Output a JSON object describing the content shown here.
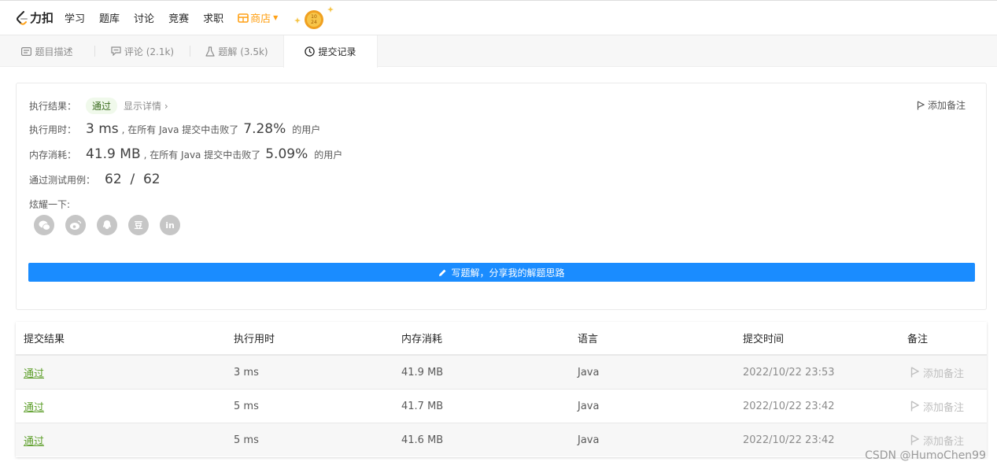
{
  "topnav": {
    "logo_text": "力扣",
    "items": [
      "学习",
      "题库",
      "讨论",
      "竞赛",
      "求职"
    ],
    "store_label": "商店"
  },
  "tabs": [
    {
      "label": "题目描述",
      "icon": "description-icon"
    },
    {
      "label": "评论 (2.1k)",
      "icon": "comment-icon"
    },
    {
      "label": "题解 (3.5k)",
      "icon": "flask-icon"
    },
    {
      "label": "提交记录",
      "icon": "clock-icon"
    }
  ],
  "result": {
    "label_result": "执行结果：",
    "badge": "通过",
    "details_link": "显示详情 ›",
    "add_note": "添加备注",
    "label_time": "执行用时：",
    "time_value": "3 ms",
    "time_mid": ", 在所有 Java 提交中击败了",
    "time_pct": "7.28%",
    "time_suffix": "的用户",
    "label_mem": "内存消耗：",
    "mem_value": "41.9 MB",
    "mem_mid": ", 在所有 Java 提交中击败了",
    "mem_pct": "5.09%",
    "mem_suffix": "的用户",
    "label_cases": "通过测试用例：",
    "cases_value": "62  /  62",
    "label_share": "炫耀一下:",
    "share_icons": [
      "wechat-icon",
      "weibo-icon",
      "qq-icon",
      "douban-icon",
      "linkedin-icon"
    ],
    "share_glyphs": [
      "",
      "",
      "",
      "豆",
      "in"
    ],
    "write_button": "写题解，分享我的解题思路"
  },
  "table": {
    "headers": [
      "提交结果",
      "执行用时",
      "内存消耗",
      "语言",
      "提交时间",
      "备注"
    ],
    "rows": [
      {
        "status": "通过",
        "runtime": "3 ms",
        "memory": "41.9 MB",
        "lang": "Java",
        "time": "2022/10/22 23:53",
        "note": "添加备注"
      },
      {
        "status": "通过",
        "runtime": "5 ms",
        "memory": "41.7 MB",
        "lang": "Java",
        "time": "2022/10/22 23:42",
        "note": "添加备注"
      },
      {
        "status": "通过",
        "runtime": "5 ms",
        "memory": "41.6 MB",
        "lang": "Java",
        "time": "2022/10/22 23:42",
        "note": "添加备注"
      }
    ]
  },
  "watermark": "CSDN @HumoChen99",
  "colors": {
    "accent": "#1a8cff",
    "pass": "#5c9e29",
    "store": "#ffa116"
  }
}
